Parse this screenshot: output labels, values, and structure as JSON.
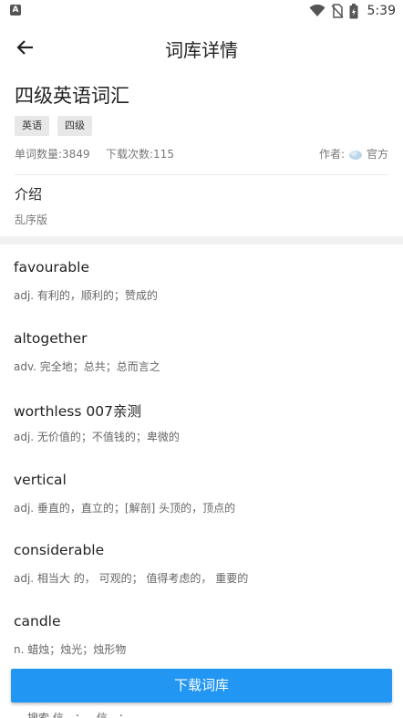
{
  "status_bar": {
    "time": "5:39",
    "app_icon_letter": "A"
  },
  "app_bar": {
    "title": "词库详情"
  },
  "wordbook": {
    "title": "四级英语词汇",
    "tags": [
      "英语",
      "四级"
    ],
    "word_count": "单词数量:3849",
    "download_count": "下载次数:115",
    "author_label": "作者:",
    "author_name": "官方",
    "intro_heading": "介绍",
    "intro_text": "乱序版"
  },
  "words": [
    {
      "word": "favourable",
      "meaning": "adj. 有利的，顺利的；赞成的"
    },
    {
      "word": "altogether",
      "meaning": "adv. 完全地；总共；总而言之"
    },
    {
      "word": "worthless 007亲测",
      "meaning": "adj. 无价值的；不值钱的；卑微的"
    },
    {
      "word": "vertical",
      "meaning": "adj. 垂直的，直立的；[解剖] 头顶的，顶点的"
    },
    {
      "word": "considerable",
      "meaning": "adj.  相当大  的，  可观的；  值得考虑的，  重要的"
    },
    {
      "word": "candle",
      "meaning": "n. 蜡烛；烛光；烛形物"
    }
  ],
  "cutoff_text": "搜索    信…；…信…；…",
  "download_button": "下载词库",
  "colors": {
    "accent": "#2196f3",
    "divider": "#f1f1f1"
  }
}
